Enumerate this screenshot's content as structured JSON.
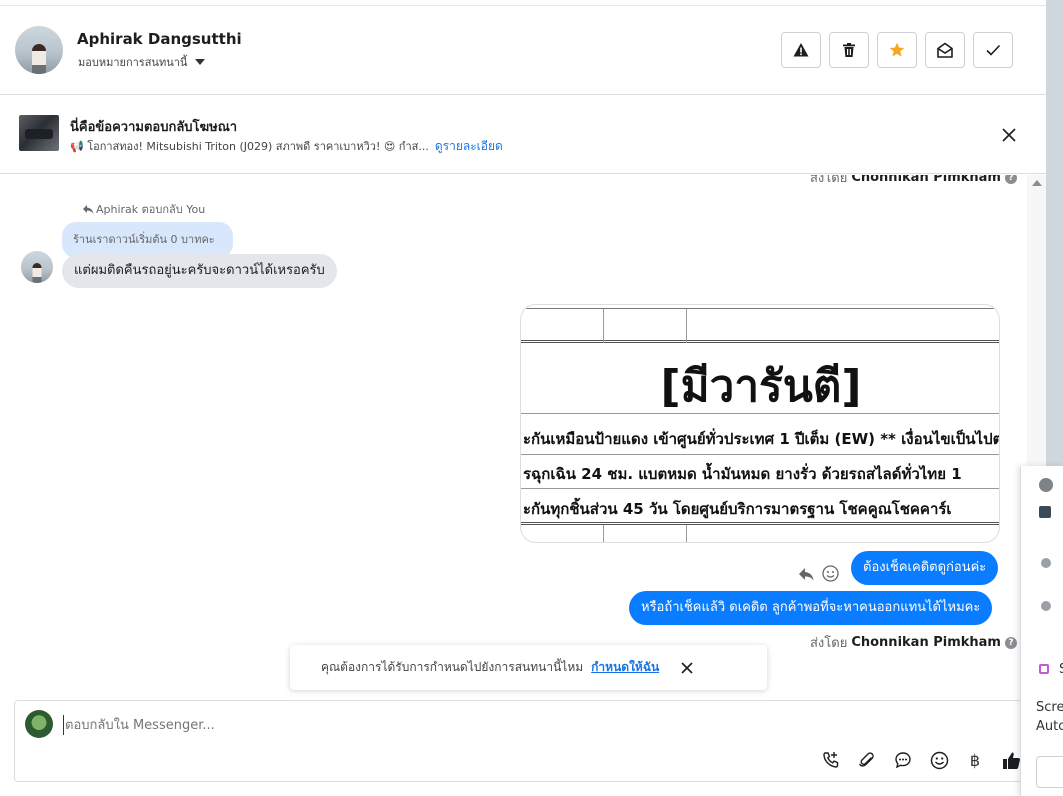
{
  "header": {
    "contact_name": "Aphirak Dangsutthi",
    "assign_label": "มอบหมายการสนทนานี้",
    "actions": [
      "spam-warning",
      "delete",
      "star",
      "mark-unread",
      "done"
    ]
  },
  "ad": {
    "title": "นี่คือข้อความตอบกลับโฆษณา",
    "preview": "📢 โอกาสทอง! Mitsubishi Triton (J029) สภาพดี ราคาเบาหวิว! 😍 กำส...",
    "details_link": "ดูรายละเอียด"
  },
  "thread": {
    "top_sent_by_prefix": "ส่งโดย",
    "top_sent_by_name": "Chonnikan Pimkham",
    "reply_header": "Aphirak ตอบกลับ You",
    "quoted_text": "ร้านเราดาวน์เริ่มต้น 0 บาทคะ",
    "incoming_message": "แต่ผมติดคืนรถอยู่นะครับจะดาวน์ได้เหรอครับ",
    "image_card": {
      "title": "[มีวารันตี]",
      "rows": [
        "ะกันเหมือนป้ายแดง เข้าศูนย์ทั่วประเทศ 1 ปีเต็ม (EW) ** เงื่อนไขเป็นไปตามที่บ",
        "รฉุกเฉิน 24 ชม. แบตหมด น้ำมันหมด ยางรั่ว ด้วยรถสไลด์ทั่วไทย 1",
        "ะกันทุกชิ้นส่วน 45 วัน โดยศูนย์บริการมาตรฐาน โชคคูณโชคคาร์เ"
      ]
    },
    "outgoing_messages": [
      "ต้องเช็คเคดิตดูก่อนค่ะ",
      "หรือถ้าเช็คแล้วิ ดเคดิต ลูกค้าพอที่จะหาคนออกแทนได้ไหมคะ"
    ],
    "bottom_sent_by_prefix": "ส่งโดย",
    "bottom_sent_by_name": "Chonnikan Pimkham"
  },
  "toast": {
    "text": "คุณต้องการได้รับการกำหนดไปยังการสนทนานี้ไหม",
    "link": "กำหนดให้ฉัน"
  },
  "composer": {
    "placeholder": "ตอบกลับใน Messenger...",
    "currency_symbol": "฿"
  },
  "side_panel": {
    "text_1": "S",
    "text_2": "Scre",
    "text_3": "Auto"
  },
  "colors": {
    "accent": "#0a7cff",
    "link": "#1b74e4",
    "star": "#f5a623",
    "quoted_bg": "#d8e7fb",
    "incoming_bg": "#e4e6eb"
  }
}
